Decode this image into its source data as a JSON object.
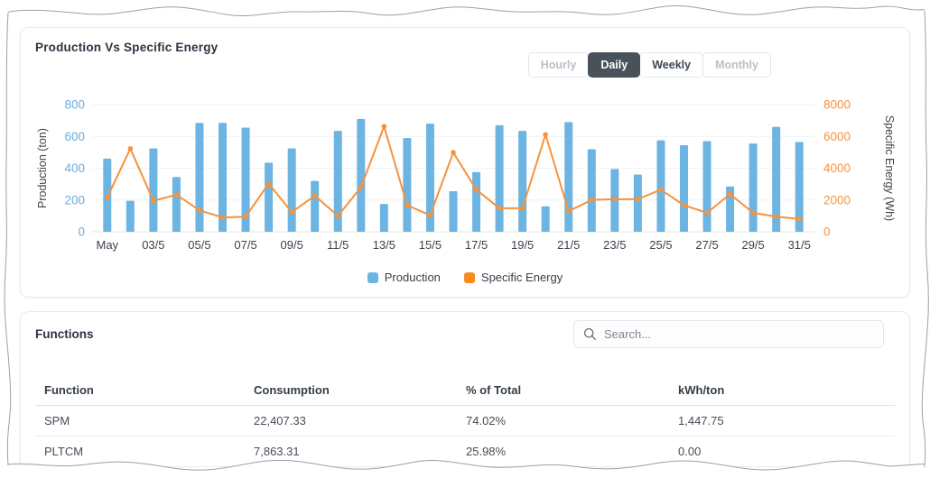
{
  "chart_card": {
    "title": "Production Vs Specific Energy",
    "range_buttons": [
      {
        "label": "Hourly",
        "state": "muted"
      },
      {
        "label": "Daily",
        "state": "active"
      },
      {
        "label": "Weekly",
        "state": "normal"
      },
      {
        "label": "Monthly",
        "state": "muted"
      }
    ],
    "legend": [
      {
        "label": "Production",
        "color": "#6cb4e1"
      },
      {
        "label": "Specific Energy",
        "color": "#f88d20"
      }
    ]
  },
  "chart_data": {
    "type": "bar",
    "subtype": "bar+line combo, dual axis",
    "title": "Production Vs Specific Energy",
    "x_tick_labels": [
      "May",
      "03/5",
      "05/5",
      "07/5",
      "09/5",
      "11/5",
      "13/5",
      "15/5",
      "17/5",
      "19/5",
      "21/5",
      "23/5",
      "25/5",
      "27/5",
      "29/5",
      "31/5"
    ],
    "label_every_n_bars": 2,
    "n_points": 31,
    "grid": "horizontal gridlines only",
    "legend_position": "bottom",
    "left_axis": {
      "title": "Production (ton)",
      "ticks": [
        0,
        200,
        400,
        600,
        800
      ],
      "range": [
        0,
        800
      ],
      "color": "#67aede"
    },
    "right_axis": {
      "title": "Specific Energy (Wh)",
      "ticks": [
        0,
        2000,
        4000,
        6000,
        8000
      ],
      "range": [
        0,
        8000
      ],
      "color": "#f7923d"
    },
    "series": [
      {
        "name": "Production",
        "type": "bar",
        "axis": "left",
        "color": "#6cb4e1",
        "values": [
          460,
          195,
          525,
          345,
          685,
          685,
          655,
          435,
          525,
          320,
          635,
          710,
          175,
          590,
          680,
          255,
          375,
          670,
          635,
          160,
          690,
          520,
          395,
          360,
          575,
          545,
          570,
          285,
          555,
          660,
          565
        ]
      },
      {
        "name": "Specific Energy",
        "type": "line",
        "axis": "right",
        "color": "#f7923d",
        "values": [
          2150,
          5230,
          1950,
          2330,
          1350,
          900,
          950,
          3030,
          1230,
          2270,
          1000,
          2800,
          6630,
          1670,
          1040,
          4990,
          2650,
          1480,
          1480,
          6120,
          1290,
          2010,
          2050,
          2050,
          2650,
          1670,
          1190,
          2370,
          1190,
          950,
          810
        ]
      }
    ]
  },
  "functions_card": {
    "title": "Functions",
    "search_placeholder": "Search...",
    "table": {
      "columns": [
        "Function",
        "Consumption",
        "% of Total",
        "kWh/ton"
      ],
      "rows": [
        [
          "SPM",
          "22,407.33",
          "74.02%",
          "1,447.75"
        ],
        [
          "PLTCM",
          "7,863.31",
          "25.98%",
          "0.00"
        ]
      ]
    }
  }
}
